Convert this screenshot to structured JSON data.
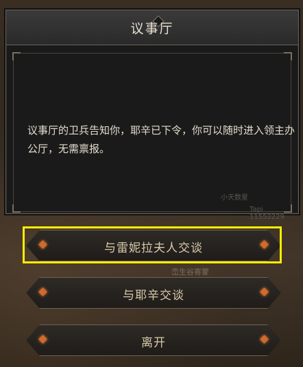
{
  "dialog": {
    "title": "议事厅",
    "message": "议事厅的卫兵告知你，耶辛已下令，你可以随时进入领主办公厅，无需禀报。",
    "watermark_name": "小天数星",
    "watermark_id": "Tapi 11552229"
  },
  "choices": [
    {
      "label": "与雷妮拉夫人交谈"
    },
    {
      "label": "与耶辛交谈"
    },
    {
      "label": "离开"
    }
  ],
  "background_text": "峦生谷寄蒙",
  "colors": {
    "highlight": "#ffee00",
    "gem": "#d26a2a",
    "label": "#d9c9a8"
  }
}
